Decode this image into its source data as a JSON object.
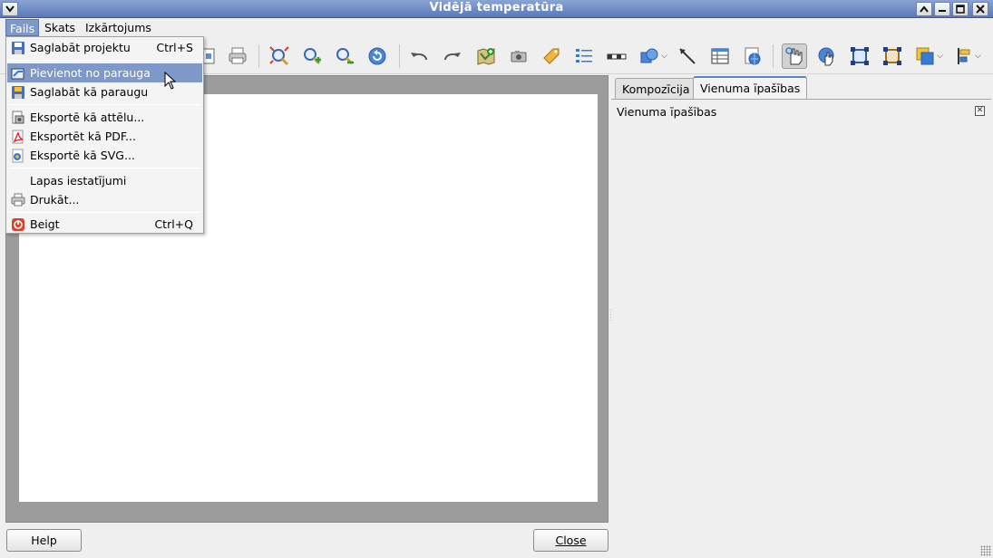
{
  "window": {
    "title": "Vidējā temperatūra"
  },
  "menubar": {
    "items": [
      "Fails",
      "Skats",
      "Izkārtojums"
    ]
  },
  "file_menu": {
    "save_project": {
      "label": "Saglabāt projektu",
      "shortcut": "Ctrl+S"
    },
    "add_from_template": {
      "label": "Pievienot no parauga"
    },
    "save_as_template": {
      "label": "Saglabāt kā paraugu"
    },
    "export_image": {
      "label": "Eksportē kā attēlu..."
    },
    "export_pdf": {
      "label": "Eksportēt kā PDF..."
    },
    "export_svg": {
      "label": "Eksportē kā SVG..."
    },
    "page_setup": {
      "label": "Lapas iestatījumi"
    },
    "print": {
      "label": "Drukāt..."
    },
    "quit": {
      "label": "Beigt",
      "shortcut": "Ctrl+Q"
    }
  },
  "tabs": [
    "Kompozīcija",
    "Vienuma īpašības"
  ],
  "panel": {
    "title": "Vienuma īpašības"
  },
  "buttons": {
    "help": "Help",
    "close": "Close"
  },
  "colors": {
    "titlebar": "#6b86c2",
    "highlight": "#7d98c9",
    "canvas_bg": "#9c9c9c"
  }
}
